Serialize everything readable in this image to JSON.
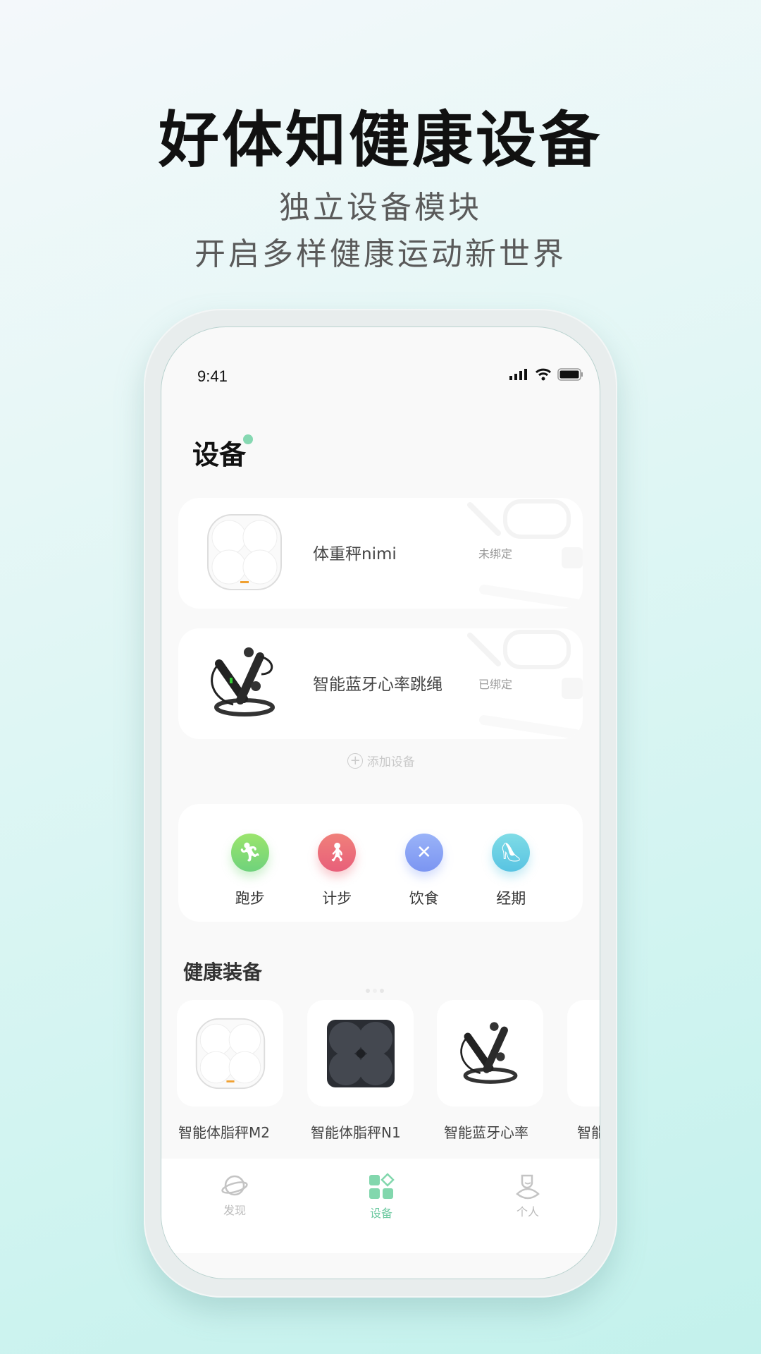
{
  "promo": {
    "headline": "好体知健康设备",
    "sub1": "独立设备模块",
    "sub2": "开启多样健康运动新世界"
  },
  "status": {
    "time": "9:41",
    "icons": [
      "signal-icon",
      "wifi-icon",
      "battery-icon"
    ]
  },
  "page": {
    "title": "设备",
    "accent": "#86d8b2"
  },
  "devices": [
    {
      "name": "体重秤nimi",
      "status": "未绑定",
      "image": "white-scale"
    },
    {
      "name": "智能蓝牙心率跳绳",
      "status": "已绑定",
      "image": "jump-rope"
    }
  ],
  "add_device": {
    "label": "添加设备",
    "icon": "plus-circle-icon"
  },
  "quick_actions": [
    {
      "label": "跑步",
      "icon": "running-icon",
      "color": "#7cd77a"
    },
    {
      "label": "计步",
      "icon": "walking-icon",
      "color": "#ec6d78"
    },
    {
      "label": "饮食",
      "icon": "fork-knife-icon",
      "color": "#8aa3f5"
    },
    {
      "label": "经期",
      "icon": "high-heel-icon",
      "color": "#62c9e3"
    }
  ],
  "equipment": {
    "title": "健康装备",
    "items": [
      {
        "label": "智能体脂秤M2",
        "image": "white-scale"
      },
      {
        "label": "智能体脂秤N1",
        "image": "black-scale"
      },
      {
        "label": "智能蓝牙心率",
        "image": "jump-rope"
      },
      {
        "label": "智能",
        "image": "jump-rope"
      }
    ]
  },
  "tabs": [
    {
      "label": "发现",
      "icon": "planet-icon",
      "active": false
    },
    {
      "label": "设备",
      "icon": "grid-icon",
      "active": true
    },
    {
      "label": "个人",
      "icon": "person-icon",
      "active": false
    }
  ]
}
